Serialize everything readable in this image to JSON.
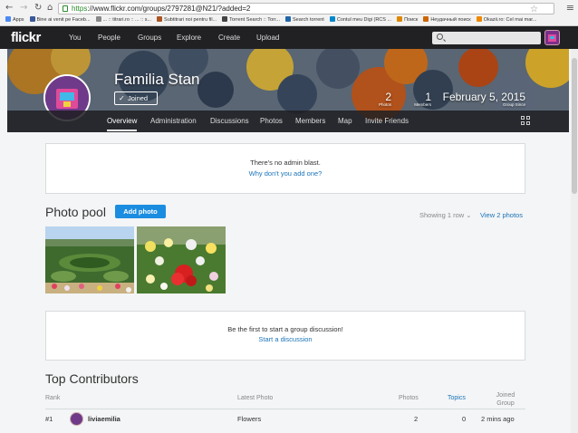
{
  "browser": {
    "url_https": "https",
    "url_rest": "://www.flickr.com/groups/2797281@N21/?added=2",
    "bookmarks": [
      {
        "label": "Apps",
        "color": "#4a8af4"
      },
      {
        "label": "Bine ai venit pe Faceb...",
        "color": "#3b5998"
      },
      {
        "label": "... :: titrari.ro :: ... :: s...",
        "color": "#888888"
      },
      {
        "label": "Subtitrari noi pentru fil...",
        "color": "#aa5522"
      },
      {
        "label": "Torrent Search :: Torr...",
        "color": "#444444"
      },
      {
        "label": "Search torrent",
        "color": "#2266aa"
      },
      {
        "label": "Contul meu Digi (RCS ...",
        "color": "#0088cc"
      },
      {
        "label": "Поиск",
        "color": "#dd8800"
      },
      {
        "label": "Неудачный поиск",
        "color": "#cc6600"
      },
      {
        "label": "Okazii.ro: Cel mai mar...",
        "color": "#ee8800"
      }
    ]
  },
  "topnav": {
    "logo": "flickr",
    "items": [
      "You",
      "People",
      "Groups",
      "Explore",
      "Create",
      "Upload"
    ]
  },
  "group": {
    "name": "Familia Stan",
    "joined_label": "Joined",
    "photos_count": "2",
    "photos_label": "Photos",
    "members_count": "1",
    "members_label": "Members",
    "since_date": "February 5, 2015",
    "since_label": "Group Since"
  },
  "subnav": [
    "Overview",
    "Administration",
    "Discussions",
    "Photos",
    "Members",
    "Map",
    "Invite Friends"
  ],
  "admin_blast": {
    "text": "There's no admin blast.",
    "link": "Why don't you add one?"
  },
  "photo_pool": {
    "title": "Photo pool",
    "add_button": "Add photo",
    "showing": "Showing 1 row",
    "view_all": "View 2 photos"
  },
  "discussion": {
    "text": "Be the first to start a group discussion!",
    "link": "Start a discussion"
  },
  "contributors": {
    "title": "Top Contributors",
    "headers": {
      "rank": "Rank",
      "latest": "Latest Photo",
      "photos": "Photos",
      "topics": "Topics",
      "joined": "Joined Group"
    },
    "rows": [
      {
        "rank": "#1",
        "user": "liviaemilia",
        "latest": "Flowers",
        "photos": "2",
        "topics": "0",
        "joined": "2 mins ago"
      }
    ]
  },
  "colors": {
    "accent": "#1b8de0",
    "link": "#1b74b8",
    "nav_bg": "#212124"
  }
}
